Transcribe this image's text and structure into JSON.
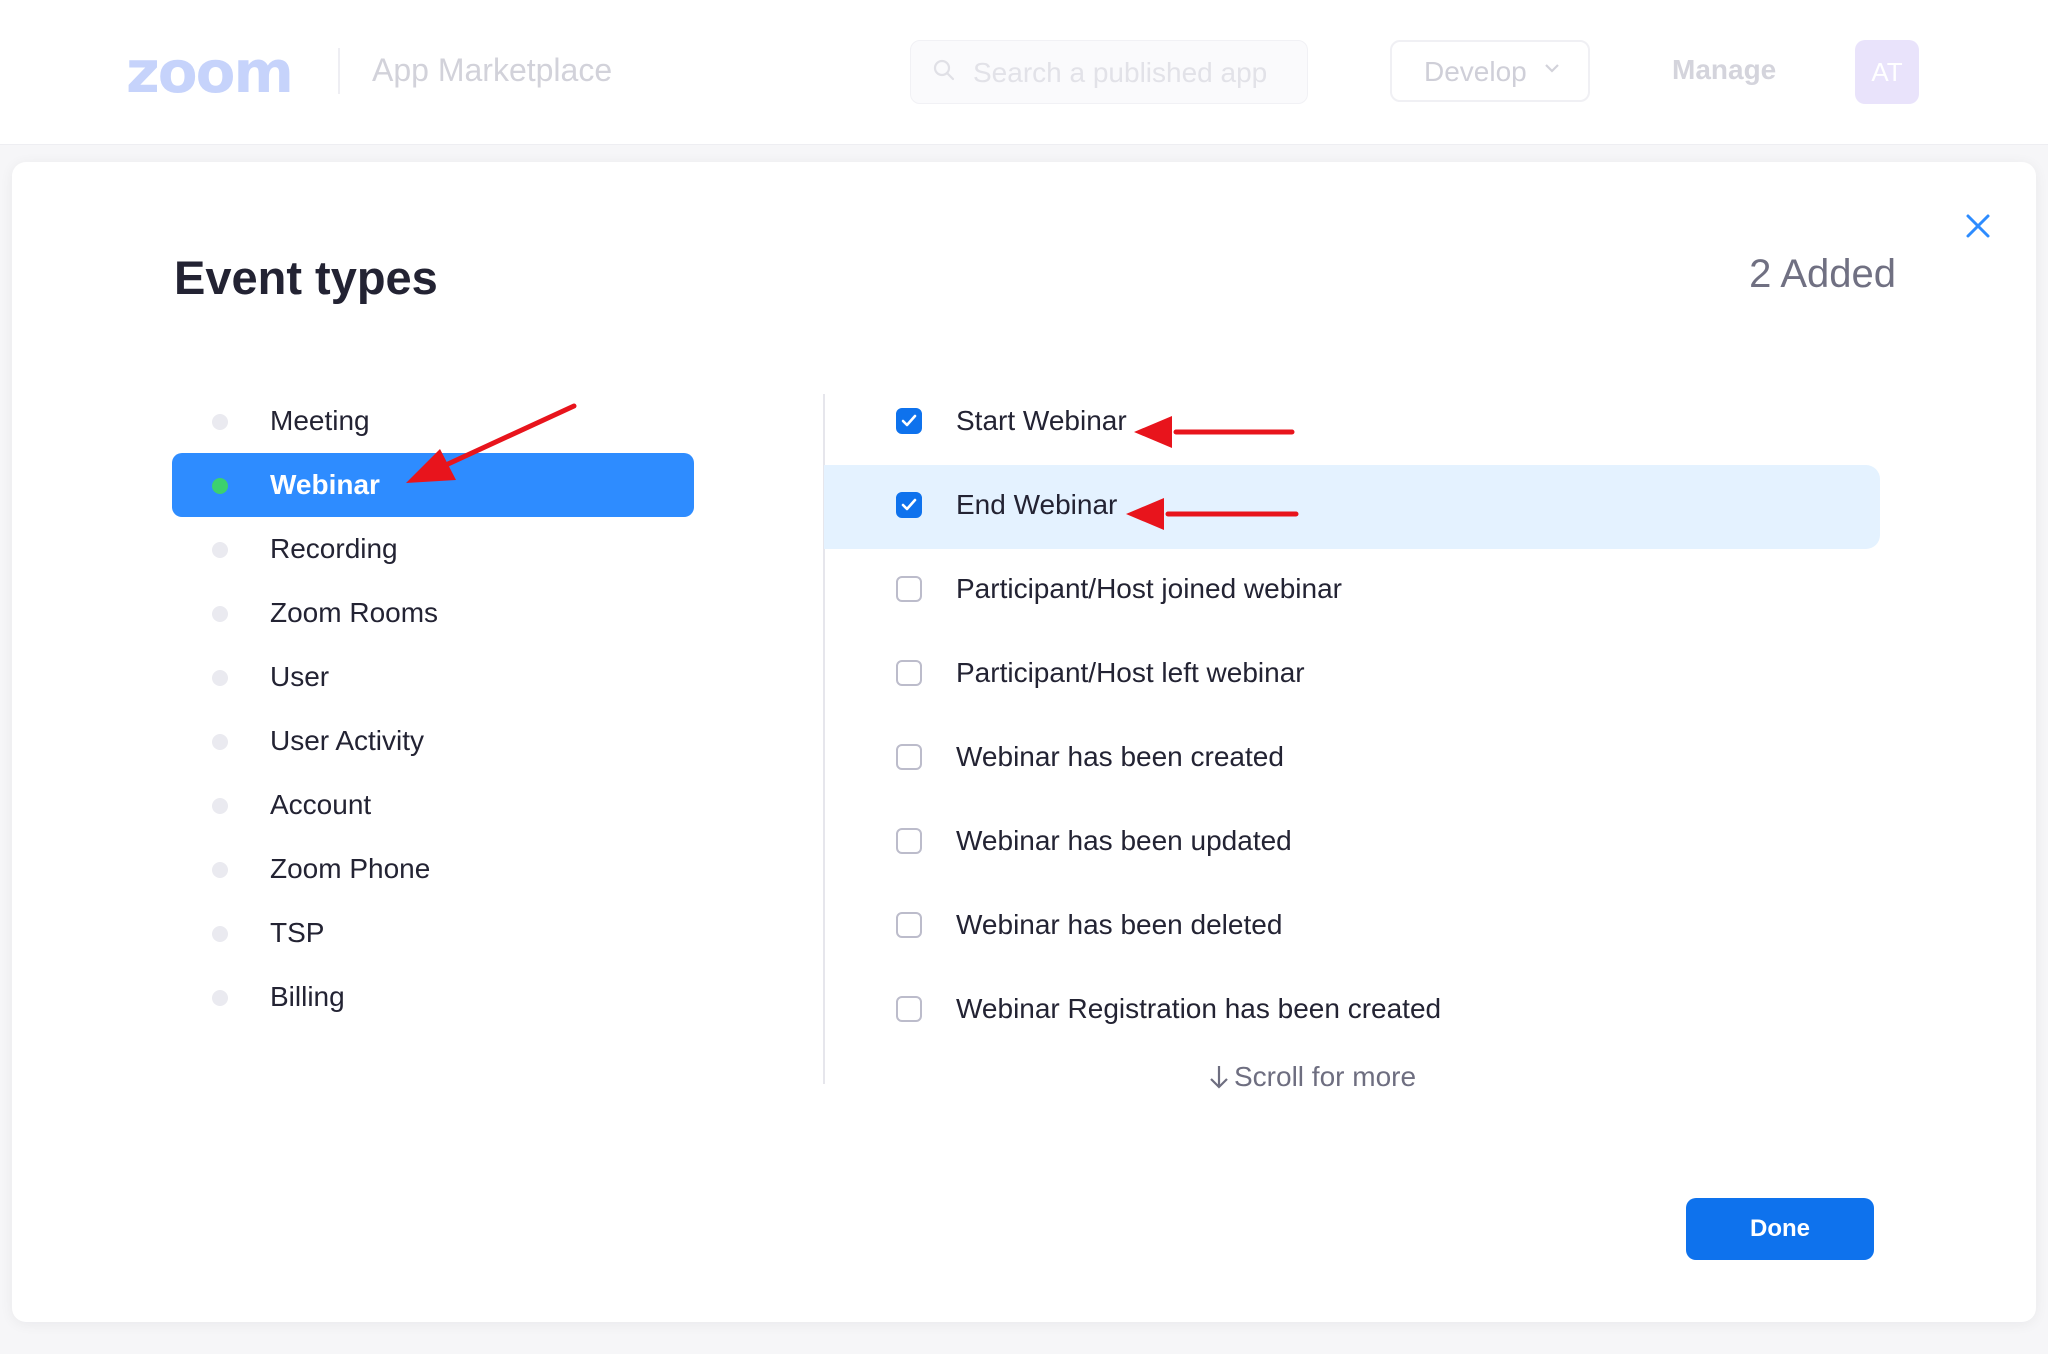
{
  "header": {
    "logo_text": "zoom",
    "app_name": "App Marketplace",
    "search_placeholder": "Search a published app",
    "develop_label": "Develop",
    "manage_label": "Manage",
    "avatar_initials": "AT"
  },
  "modal": {
    "title": "Event types",
    "added_count": "2 Added",
    "scroll_hint": "Scroll for more",
    "done_label": "Done"
  },
  "categories": [
    {
      "label": "Meeting",
      "active": false
    },
    {
      "label": "Webinar",
      "active": true
    },
    {
      "label": "Recording",
      "active": false
    },
    {
      "label": "Zoom Rooms",
      "active": false
    },
    {
      "label": "User",
      "active": false
    },
    {
      "label": "User Activity",
      "active": false
    },
    {
      "label": "Account",
      "active": false
    },
    {
      "label": "Zoom Phone",
      "active": false
    },
    {
      "label": "TSP",
      "active": false
    },
    {
      "label": "Billing",
      "active": false
    }
  ],
  "events": [
    {
      "label": "Start Webinar",
      "checked": true
    },
    {
      "label": "End Webinar",
      "checked": true
    },
    {
      "label": "Participant/Host joined webinar",
      "checked": false
    },
    {
      "label": "Participant/Host left webinar",
      "checked": false
    },
    {
      "label": "Webinar has been created",
      "checked": false
    },
    {
      "label": "Webinar has been updated",
      "checked": false
    },
    {
      "label": "Webinar has been deleted",
      "checked": false
    },
    {
      "label": "Webinar Registration has been created",
      "checked": false
    }
  ],
  "colors": {
    "primary": "#0e72ed",
    "active_category": "#2e8cff",
    "active_dot": "#3cd16f",
    "row_highlight": "#e4f2ff",
    "annotation_arrow": "#e8141c"
  },
  "icons": {
    "close": "close-icon",
    "search": "search-icon",
    "dropdown": "chevron-down-icon",
    "scroll": "arrow-down-icon",
    "check": "checkmark-icon"
  }
}
